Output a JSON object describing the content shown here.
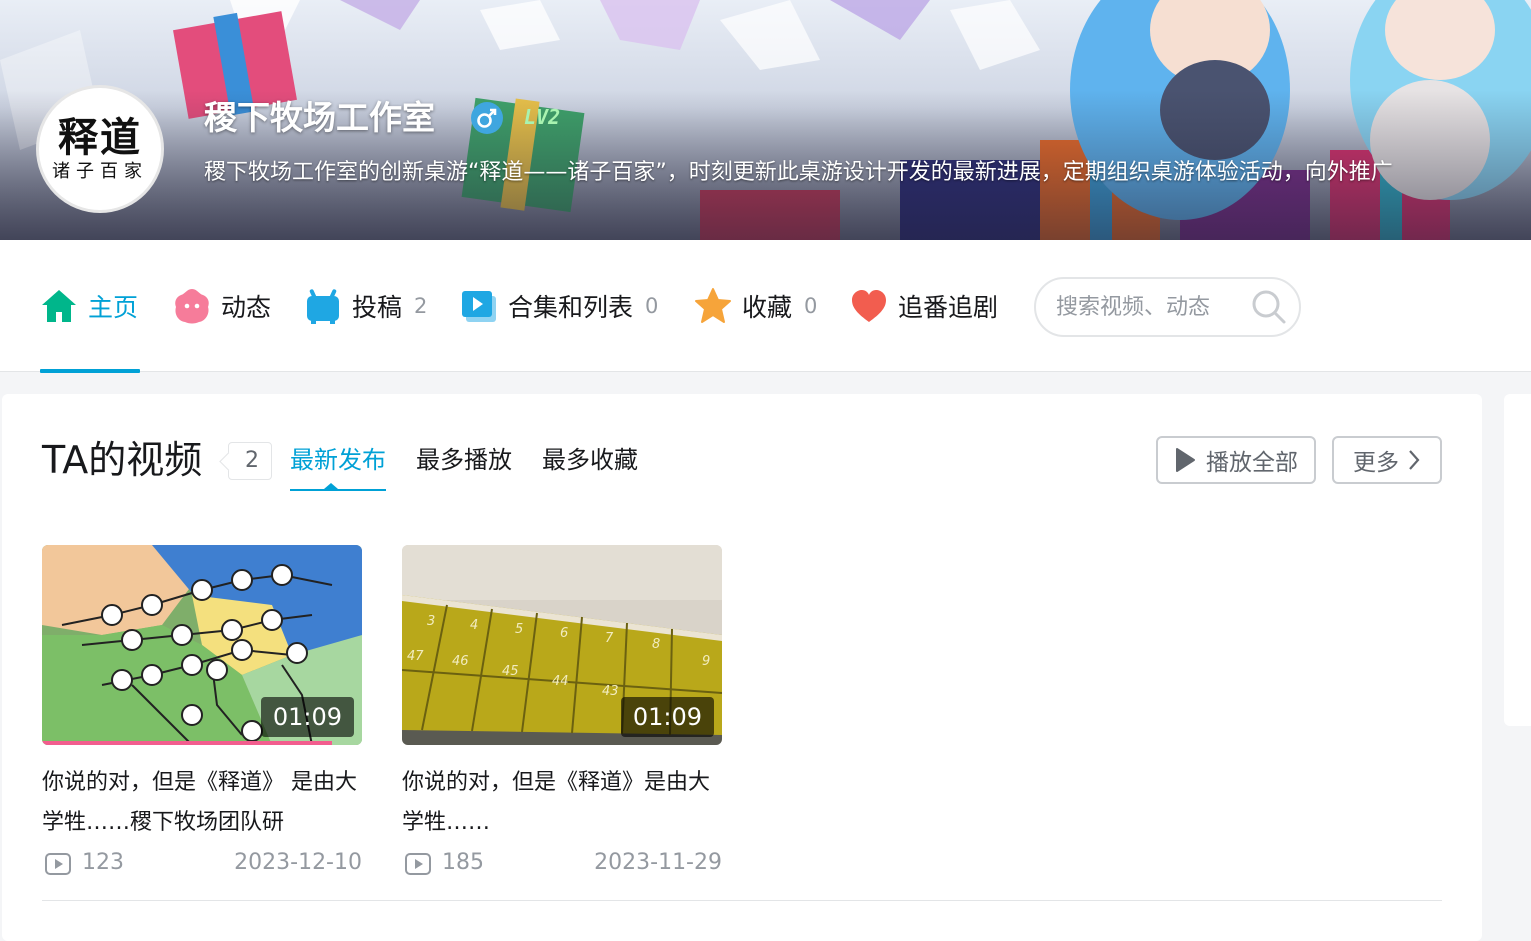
{
  "profile": {
    "avatar_text_main": "释道",
    "avatar_text_sub": "诸子百家",
    "name": "稷下牧场工作室",
    "gender_icon": "male-icon",
    "level": "LV2",
    "signature": "稷下牧场工作室的创新桌游“释道——诸子百家”，时刻更新此桌游设计开发的最新进展，定期组织桌游体验活动，向外推广"
  },
  "nav": {
    "items": [
      {
        "label": "主页",
        "count": "",
        "icon": "home-icon",
        "active": true
      },
      {
        "label": "动态",
        "count": "",
        "icon": "dynamic-icon"
      },
      {
        "label": "投稿",
        "count": "2",
        "icon": "tv-icon"
      },
      {
        "label": "合集和列表",
        "count": "0",
        "icon": "collection-icon"
      },
      {
        "label": "收藏",
        "count": "0",
        "icon": "star-icon"
      },
      {
        "label": "追番追剧",
        "count": "",
        "icon": "heart-icon"
      }
    ],
    "search_placeholder": "搜索视频、动态"
  },
  "videos_section": {
    "title": "TA的视频",
    "count": "2",
    "sort_tabs": [
      "最新发布",
      "最多播放",
      "最多收藏"
    ],
    "active_sort": "最新发布",
    "play_all_label": "播放全部",
    "more_label": "更多",
    "items": [
      {
        "title": "你说的对，但是《释道》 是由大学牲……稷下牧场团队研",
        "duration": "01:09",
        "plays": "123",
        "date": "2023-12-10",
        "watch_progress": 0.906
      },
      {
        "title": "你说的对，但是《释道》是由大学牲……",
        "duration": "01:09",
        "plays": "185",
        "date": "2023-11-29"
      }
    ]
  },
  "colors": {
    "accent": "#00a1d6",
    "progress": "#f25d8e",
    "text_primary": "#18191c",
    "text_secondary": "#9499a0"
  }
}
